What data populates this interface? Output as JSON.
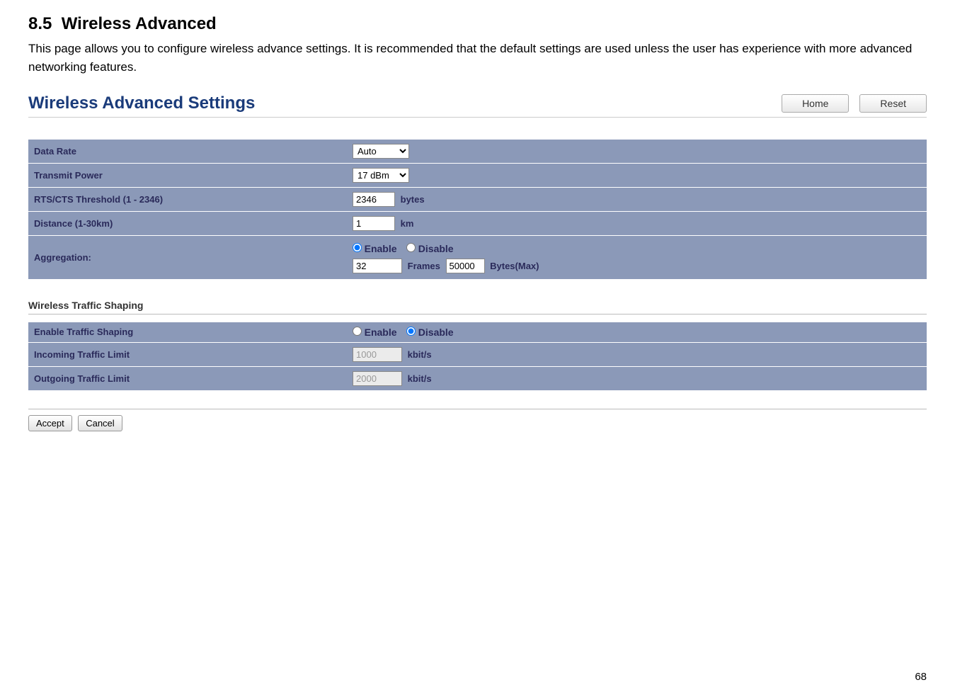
{
  "section": {
    "number": "8.5",
    "title": "Wireless Advanced",
    "intro": "This page allows you to configure wireless advance settings. It is recommended that the default settings are used unless the user has experience with more advanced networking features."
  },
  "page": {
    "title": "Wireless Advanced Settings",
    "home_btn": "Home",
    "reset_btn": "Reset"
  },
  "settings": {
    "data_rate": {
      "label": "Data Rate",
      "value": "Auto"
    },
    "transmit_power": {
      "label": "Transmit Power",
      "value": "17 dBm"
    },
    "rts_cts": {
      "label": "RTS/CTS Threshold (1 - 2346)",
      "value": "2346",
      "unit": "bytes"
    },
    "distance": {
      "label": "Distance (1-30km)",
      "value": "1",
      "unit": "km"
    },
    "aggregation": {
      "label": "Aggregation:",
      "enable": "Enable",
      "disable": "Disable",
      "frames_value": "32",
      "frames_label": "Frames",
      "bytes_value": "50000",
      "bytes_label": "Bytes(Max)"
    }
  },
  "traffic_shaping": {
    "title": "Wireless Traffic Shaping",
    "enable_row": {
      "label": "Enable Traffic Shaping",
      "enable": "Enable",
      "disable": "Disable"
    },
    "incoming": {
      "label": "Incoming Traffic Limit",
      "value": "1000",
      "unit": "kbit/s"
    },
    "outgoing": {
      "label": "Outgoing Traffic Limit",
      "value": "2000",
      "unit": "kbit/s"
    }
  },
  "buttons": {
    "accept": "Accept",
    "cancel": "Cancel"
  },
  "page_number": "68"
}
